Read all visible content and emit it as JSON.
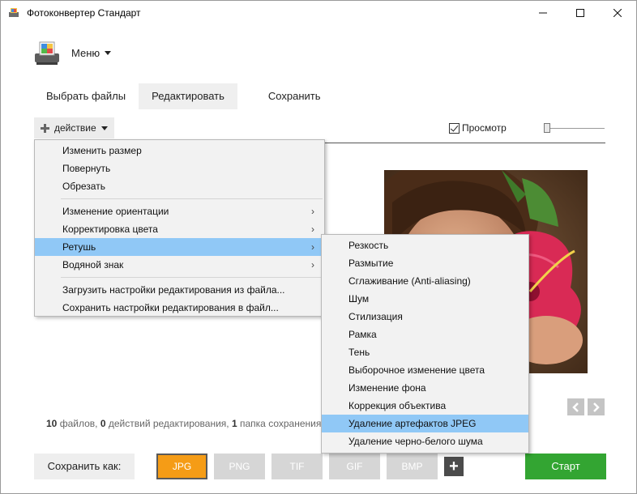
{
  "window": {
    "title": "Фотоконвертер Стандарт",
    "controls": [
      "minimize",
      "maximize",
      "close"
    ]
  },
  "header": {
    "menu_label": "Меню"
  },
  "tabs": [
    {
      "label": "Выбрать файлы",
      "active": false
    },
    {
      "label": "Редактировать",
      "active": true
    },
    {
      "label": "Сохранить",
      "active": false
    }
  ],
  "toolbar": {
    "action_label": "действие",
    "preview_label": "Просмотр",
    "preview_checked": true,
    "zoom_level": 0
  },
  "action_menu": {
    "items": [
      {
        "label": "Изменить размер",
        "submenu": false
      },
      {
        "label": "Повернуть",
        "submenu": false
      },
      {
        "label": "Обрезать",
        "submenu": false
      },
      {
        "label": "Изменение ориентации",
        "submenu": true
      },
      {
        "label": "Корректировка цвета",
        "submenu": true
      },
      {
        "label": "Ретушь",
        "submenu": true,
        "highlighted": true
      },
      {
        "label": "Водяной знак",
        "submenu": true
      },
      {
        "label": "Загрузить настройки редактирования из файла...",
        "submenu": false
      },
      {
        "label": "Сохранить настройки редактирования в файл...",
        "submenu": false
      }
    ]
  },
  "retouch_submenu": {
    "items": [
      "Резкость",
      "Размытие",
      "Сглаживание (Anti-aliasing)",
      "Шум",
      "Стилизация",
      "Рамка",
      "Тень",
      "Выборочное изменение цвета",
      "Изменение фона",
      "Коррекция объектива",
      "Удаление артефактов JPEG",
      "Удаление черно-белого шума"
    ],
    "highlighted_index": 10
  },
  "status": {
    "files_count": "10",
    "files_label": "файлов,",
    "actions_count": "0",
    "actions_label": "действий редактирования,",
    "folders_count": "1",
    "folders_label": "папка сохранения"
  },
  "bottom": {
    "save_as_label": "Сохранить как:",
    "formats": [
      "JPG",
      "PNG",
      "TIF",
      "GIF",
      "BMP"
    ],
    "selected_format": "JPG",
    "add_format_label": "+",
    "start_label": "Старт"
  },
  "colors": {
    "accent_orange": "#f59c16",
    "start_green": "#33a532",
    "menu_highlight": "#90c8f6"
  }
}
